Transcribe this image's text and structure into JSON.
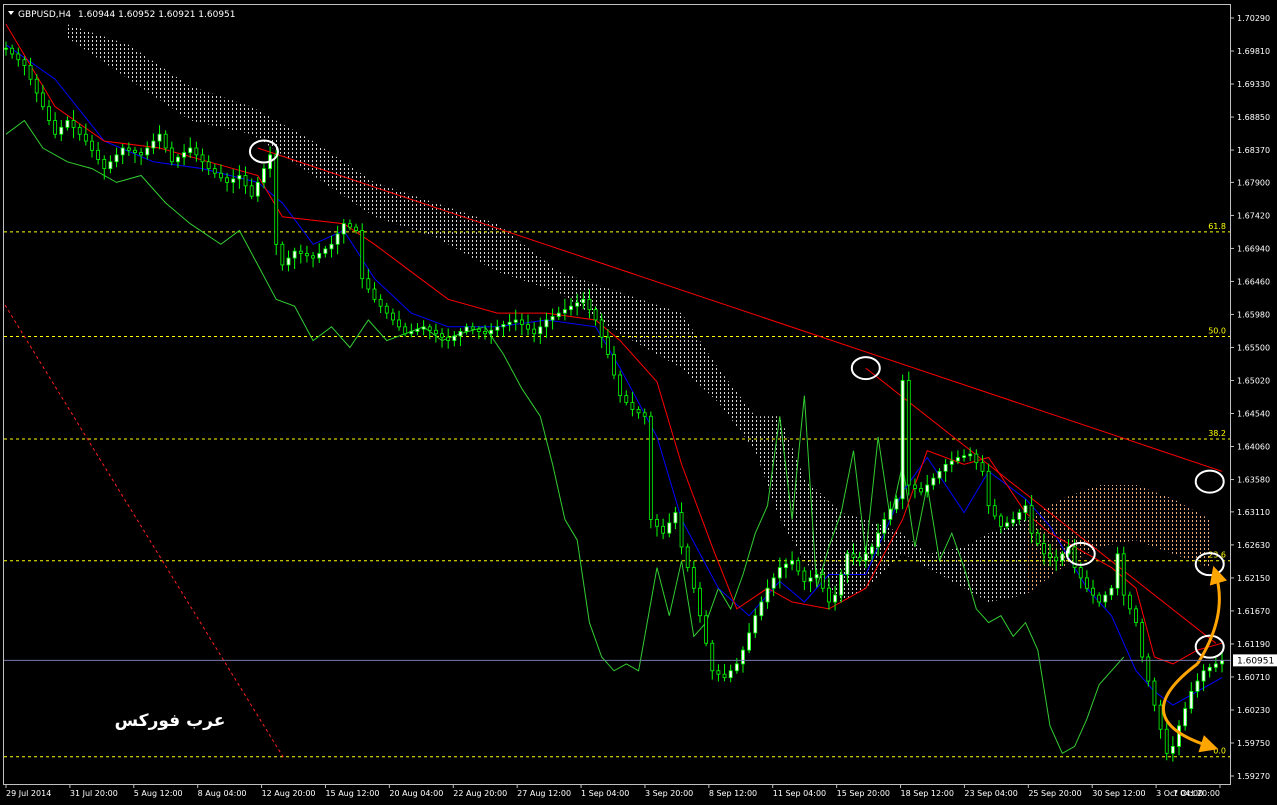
{
  "header": {
    "symbol_timeframe": "GBPUSD,H4",
    "ohlc": "1.60944 1.60952 1.60921 1.60951"
  },
  "watermark": "عرب فوركس",
  "chart_data": {
    "type": "candlestick",
    "symbol": "GBPUSD",
    "timeframe": "H4",
    "y_axis_ticks": [
      "1.70290",
      "1.69810",
      "1.69330",
      "1.68850",
      "1.68370",
      "1.67900",
      "1.67420",
      "1.66940",
      "1.66460",
      "1.65980",
      "1.65500",
      "1.65020",
      "1.64540",
      "1.64060",
      "1.63580",
      "1.63110",
      "1.62630",
      "1.62150",
      "1.61670",
      "1.61190",
      "1.60710",
      "1.60230",
      "1.59750",
      "1.59270"
    ],
    "x_axis_ticks": [
      "29 Jul 2014",
      "31 Jul 20:00",
      "5 Aug 12:00",
      "8 Aug 04:00",
      "12 Aug 20:00",
      "15 Aug 12:00",
      "20 Aug 04:00",
      "22 Aug 20:00",
      "27 Aug 12:00",
      "1 Sep 04:00",
      "3 Sep 20:00",
      "8 Sep 12:00",
      "11 Sep 04:00",
      "15 Sep 20:00",
      "18 Sep 12:00",
      "23 Sep 04:00",
      "25 Sep 20:00",
      "30 Sep 12:00",
      "3 Oct 04:00",
      "7 Oct 20:00"
    ],
    "ylim": [
      1.5927,
      1.7029
    ],
    "current_price": "1.60951",
    "price": [
      [
        0,
        1.6985
      ],
      [
        3,
        1.696
      ],
      [
        6,
        1.69
      ],
      [
        8,
        1.686
      ],
      [
        10,
        1.688
      ],
      [
        13,
        1.685
      ],
      [
        16,
        1.681
      ],
      [
        19,
        1.684
      ],
      [
        22,
        1.683
      ],
      [
        25,
        1.686
      ],
      [
        27,
        1.682
      ],
      [
        30,
        1.684
      ],
      [
        33,
        1.681
      ],
      [
        36,
        1.679
      ],
      [
        38,
        1.68
      ],
      [
        40,
        1.677
      ],
      [
        42,
        1.681
      ],
      [
        43,
        1.683
      ],
      [
        44,
        1.67
      ],
      [
        45,
        1.667
      ],
      [
        47,
        1.669
      ],
      [
        50,
        1.668
      ],
      [
        53,
        1.67
      ],
      [
        55,
        1.673
      ],
      [
        57,
        1.672
      ],
      [
        58,
        1.665
      ],
      [
        60,
        1.662
      ],
      [
        62,
        1.66
      ],
      [
        65,
        1.657
      ],
      [
        68,
        1.658
      ],
      [
        70,
        1.657
      ],
      [
        72,
        1.656
      ],
      [
        75,
        1.658
      ],
      [
        78,
        1.657
      ],
      [
        80,
        1.658
      ],
      [
        83,
        1.659
      ],
      [
        86,
        1.657
      ],
      [
        88,
        1.659
      ],
      [
        90,
        1.66
      ],
      [
        92,
        1.661
      ],
      [
        94,
        1.662
      ],
      [
        96,
        1.659
      ],
      [
        98,
        1.654
      ],
      [
        100,
        1.648
      ],
      [
        102,
        1.646
      ],
      [
        104,
        1.645
      ],
      [
        105,
        1.63
      ],
      [
        107,
        1.628
      ],
      [
        109,
        1.631
      ],
      [
        110,
        1.626
      ],
      [
        112,
        1.62
      ],
      [
        114,
        1.612
      ],
      [
        115,
        1.608
      ],
      [
        117,
        1.607
      ],
      [
        119,
        1.609
      ],
      [
        120,
        1.611
      ],
      [
        122,
        1.616
      ],
      [
        124,
        1.62
      ],
      [
        126,
        1.623
      ],
      [
        128,
        1.624
      ],
      [
        130,
        1.621
      ],
      [
        132,
        1.622
      ],
      [
        134,
        1.618
      ],
      [
        135,
        1.619
      ],
      [
        137,
        1.625
      ],
      [
        139,
        1.624
      ],
      [
        141,
        1.626
      ],
      [
        143,
        1.63
      ],
      [
        145,
        1.633
      ],
      [
        146,
        1.6502
      ],
      [
        147,
        1.635
      ],
      [
        149,
        1.634
      ],
      [
        151,
        1.636
      ],
      [
        153,
        1.638
      ],
      [
        155,
        1.639
      ],
      [
        157,
        1.6395
      ],
      [
        159,
        1.637
      ],
      [
        160,
        1.632
      ],
      [
        162,
        1.629
      ],
      [
        164,
        1.63
      ],
      [
        166,
        1.632
      ],
      [
        167,
        1.628
      ],
      [
        169,
        1.625
      ],
      [
        171,
        1.624
      ],
      [
        173,
        1.626
      ],
      [
        174,
        1.623
      ],
      [
        176,
        1.62
      ],
      [
        178,
        1.618
      ],
      [
        180,
        1.62
      ],
      [
        181,
        1.625
      ],
      [
        182,
        1.619
      ],
      [
        184,
        1.615
      ],
      [
        185,
        1.61
      ],
      [
        187,
        1.603
      ],
      [
        189,
        1.596
      ],
      [
        190,
        1.597
      ],
      [
        191,
        1.6
      ],
      [
        193,
        1.605
      ],
      [
        195,
        1.608
      ],
      [
        197,
        1.609
      ],
      [
        198,
        1.6095
      ]
    ],
    "tenkan": [
      [
        0,
        1.702
      ],
      [
        8,
        1.69
      ],
      [
        16,
        1.685
      ],
      [
        25,
        1.684
      ],
      [
        33,
        1.682
      ],
      [
        41,
        1.68
      ],
      [
        45,
        1.674
      ],
      [
        55,
        1.673
      ],
      [
        60,
        1.67
      ],
      [
        66,
        1.666
      ],
      [
        72,
        1.662
      ],
      [
        80,
        1.66
      ],
      [
        88,
        1.66
      ],
      [
        96,
        1.659
      ],
      [
        100,
        1.656
      ],
      [
        106,
        1.65
      ],
      [
        110,
        1.638
      ],
      [
        115,
        1.626
      ],
      [
        119,
        1.617
      ],
      [
        124,
        1.62
      ],
      [
        128,
        1.618
      ],
      [
        134,
        1.617
      ],
      [
        140,
        1.62
      ],
      [
        146,
        1.63
      ],
      [
        150,
        1.64
      ],
      [
        156,
        1.638
      ],
      [
        160,
        1.639
      ],
      [
        166,
        1.631
      ],
      [
        170,
        1.628
      ],
      [
        176,
        1.625
      ],
      [
        180,
        1.623
      ],
      [
        184,
        1.62
      ],
      [
        187,
        1.61
      ],
      [
        190,
        1.609
      ],
      [
        194,
        1.611
      ],
      [
        198,
        1.612
      ]
    ],
    "kijun": [
      [
        0,
        1.699
      ],
      [
        8,
        1.694
      ],
      [
        16,
        1.685
      ],
      [
        24,
        1.682
      ],
      [
        32,
        1.681
      ],
      [
        41,
        1.679
      ],
      [
        45,
        1.676
      ],
      [
        50,
        1.67
      ],
      [
        55,
        1.672
      ],
      [
        60,
        1.665
      ],
      [
        66,
        1.66
      ],
      [
        72,
        1.658
      ],
      [
        80,
        1.658
      ],
      [
        88,
        1.659
      ],
      [
        96,
        1.658
      ],
      [
        100,
        1.652
      ],
      [
        106,
        1.642
      ],
      [
        110,
        1.63
      ],
      [
        116,
        1.62
      ],
      [
        121,
        1.616
      ],
      [
        126,
        1.621
      ],
      [
        130,
        1.618
      ],
      [
        134,
        1.622
      ],
      [
        140,
        1.622
      ],
      [
        146,
        1.634
      ],
      [
        150,
        1.639
      ],
      [
        156,
        1.631
      ],
      [
        160,
        1.637
      ],
      [
        166,
        1.633
      ],
      [
        170,
        1.629
      ],
      [
        176,
        1.62
      ],
      [
        180,
        1.616
      ],
      [
        184,
        1.608
      ],
      [
        187,
        1.605
      ],
      [
        190,
        1.603
      ],
      [
        194,
        1.605
      ],
      [
        198,
        1.607
      ]
    ],
    "chikou": [
      [
        0,
        1.686
      ],
      [
        3,
        1.688
      ],
      [
        6,
        1.684
      ],
      [
        10,
        1.682
      ],
      [
        14,
        1.681
      ],
      [
        18,
        1.679
      ],
      [
        22,
        1.68
      ],
      [
        26,
        1.676
      ],
      [
        30,
        1.673
      ],
      [
        35,
        1.67
      ],
      [
        38,
        1.672
      ],
      [
        41,
        1.667
      ],
      [
        44,
        1.662
      ],
      [
        47,
        1.661
      ],
      [
        50,
        1.656
      ],
      [
        53,
        1.658
      ],
      [
        56,
        1.655
      ],
      [
        59,
        1.659
      ],
      [
        62,
        1.656
      ],
      [
        65,
        1.657
      ],
      [
        68,
        1.658
      ],
      [
        71,
        1.656
      ],
      [
        74,
        1.657
      ],
      [
        78,
        1.658
      ],
      [
        81,
        1.654
      ],
      [
        84,
        1.649
      ],
      [
        87,
        1.645
      ],
      [
        89,
        1.638
      ],
      [
        91,
        1.63
      ],
      [
        93,
        1.627
      ],
      [
        95,
        1.615
      ],
      [
        97,
        1.61
      ],
      [
        99,
        1.608
      ],
      [
        101,
        1.609
      ],
      [
        103,
        1.608
      ],
      [
        106,
        1.623
      ],
      [
        108,
        1.616
      ],
      [
        110,
        1.624
      ],
      [
        112,
        1.613
      ],
      [
        114,
        1.615
      ],
      [
        116,
        1.62
      ],
      [
        118,
        1.617
      ],
      [
        120,
        1.622
      ],
      [
        122,
        1.628
      ],
      [
        124,
        1.632
      ],
      [
        126,
        1.645
      ],
      [
        128,
        1.63
      ],
      [
        130,
        1.648
      ],
      [
        132,
        1.62
      ],
      [
        134,
        1.626
      ],
      [
        136,
        1.631
      ],
      [
        138,
        1.64
      ],
      [
        140,
        1.625
      ],
      [
        142,
        1.642
      ],
      [
        144,
        1.63
      ],
      [
        146,
        1.638
      ],
      [
        148,
        1.626
      ],
      [
        150,
        1.635
      ],
      [
        152,
        1.624
      ],
      [
        154,
        1.628
      ],
      [
        156,
        1.623
      ],
      [
        158,
        1.617
      ],
      [
        160,
        1.615
      ],
      [
        162,
        1.616
      ],
      [
        164,
        1.613
      ],
      [
        166,
        1.615
      ],
      [
        168,
        1.611
      ],
      [
        170,
        1.6
      ],
      [
        172,
        1.596
      ],
      [
        174,
        1.597
      ],
      [
        176,
        1.601
      ],
      [
        178,
        1.606
      ],
      [
        180,
        1.608
      ],
      [
        182,
        1.61
      ]
    ],
    "cloud": [
      [
        10,
        1.702,
        1.7
      ],
      [
        20,
        1.699,
        1.694
      ],
      [
        30,
        1.693,
        1.688
      ],
      [
        40,
        1.69,
        1.686
      ],
      [
        50,
        1.685,
        1.68
      ],
      [
        60,
        1.679,
        1.674
      ],
      [
        70,
        1.676,
        1.671
      ],
      [
        80,
        1.673,
        1.666
      ],
      [
        90,
        1.666,
        1.663
      ],
      [
        100,
        1.663,
        1.657
      ],
      [
        110,
        1.66,
        1.652
      ],
      [
        116,
        1.652,
        1.647
      ],
      [
        122,
        1.645,
        1.64
      ],
      [
        126,
        1.645,
        1.63
      ],
      [
        130,
        1.636,
        1.624
      ],
      [
        136,
        1.631,
        1.618
      ],
      [
        140,
        1.63,
        1.62
      ],
      [
        146,
        1.628,
        1.625
      ],
      [
        150,
        1.625,
        1.623
      ],
      [
        156,
        1.626,
        1.62
      ],
      [
        160,
        1.628,
        1.618
      ],
      [
        166,
        1.63,
        1.619
      ],
      [
        172,
        1.633,
        1.623
      ],
      [
        178,
        1.635,
        1.626
      ],
      [
        184,
        1.635,
        1.627
      ],
      [
        190,
        1.633,
        1.625
      ],
      [
        196,
        1.63,
        1.623
      ]
    ],
    "fib_levels": [
      {
        "label": "61.8",
        "value": 1.6718
      },
      {
        "label": "50.0",
        "value": 1.6566
      },
      {
        "label": "38.2",
        "value": 1.6417
      },
      {
        "label": "23.6",
        "value": 1.624
      },
      {
        "label": "0.0",
        "value": 1.5955
      }
    ],
    "trendlines": [
      {
        "x1": 41,
        "y1": 1.684,
        "x2": 198,
        "y2": 1.637
      },
      {
        "x1": 140,
        "y1": 1.652,
        "x2": 197,
        "y2": 1.612
      }
    ],
    "highlight_circles": [
      {
        "x": 42,
        "y": 1.6835
      },
      {
        "x": 140,
        "y": 1.652
      },
      {
        "x": 175,
        "y": 1.625
      },
      {
        "x": 196,
        "y": 1.6355
      },
      {
        "x": 196,
        "y": 1.6235
      },
      {
        "x": 196,
        "y": 1.6115
      }
    ],
    "annotation_arrows": [
      {
        "from": [
          194,
          1.609
        ],
        "via": [
          182,
          1.601
        ],
        "to": [
          196,
          1.597
        ]
      },
      {
        "from": [
          194,
          1.609
        ],
        "via": [
          199,
          1.616
        ],
        "to": [
          197,
          1.622
        ]
      }
    ],
    "colors": {
      "background": "#000000",
      "candles": "#00ff00",
      "chikou": "#32cd32",
      "tenkan": "#ff0000",
      "kijun": "#0000ff",
      "cloud": "#ffffff",
      "cloud_bear": "#f4a460",
      "fib": "#ffff00",
      "trendline": "#ff0000",
      "arrow": "#ffa500",
      "current_price_line": "#808080",
      "axis_text": "#ffffff"
    }
  }
}
